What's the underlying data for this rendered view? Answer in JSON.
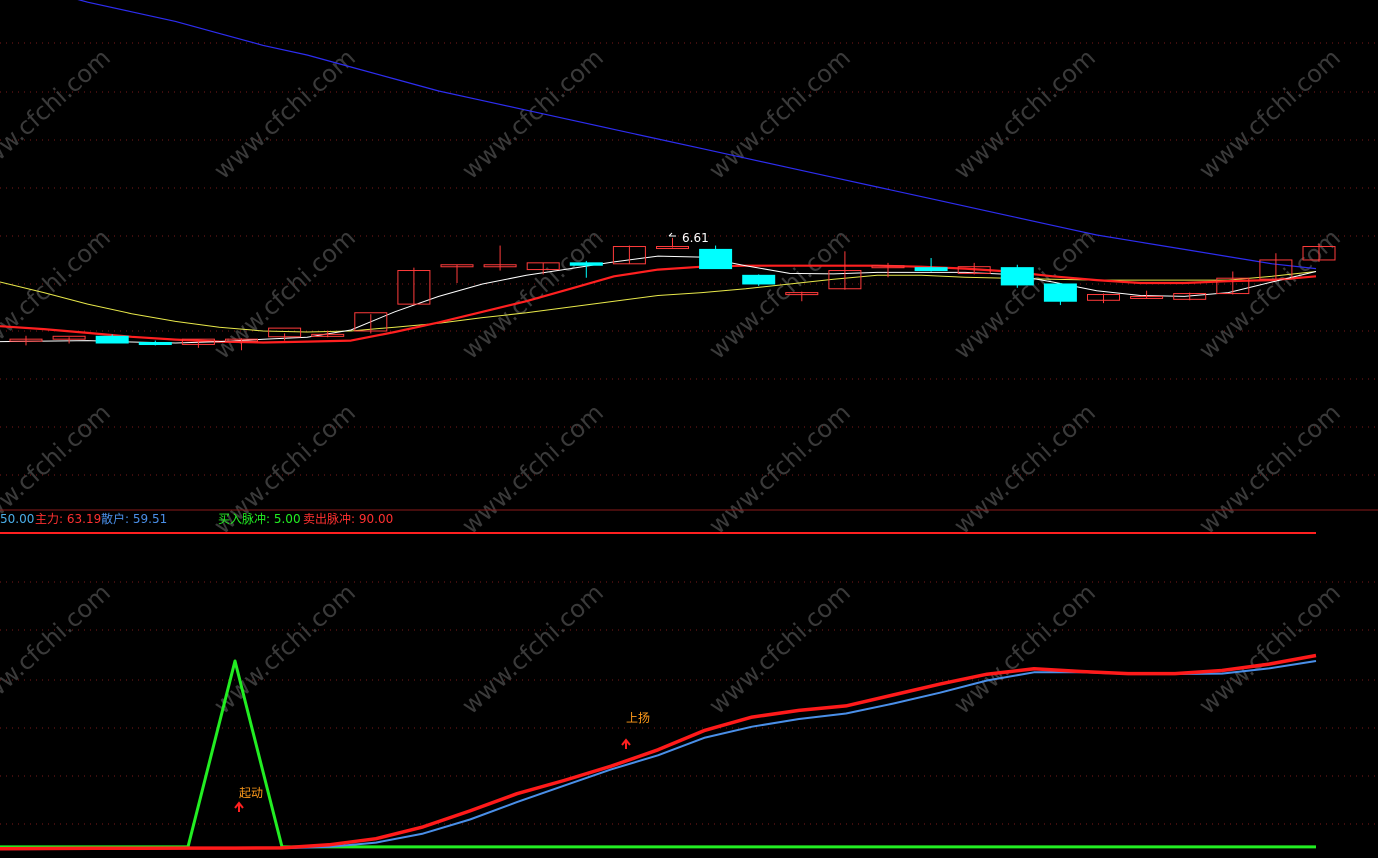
{
  "indicator_bar": {
    "level_label": "50.00",
    "main_label": "主力: 63.19",
    "retail_label": "散户: 59.51",
    "buy_label": "买入脉冲: 5.00",
    "sell_label": "卖出脉冲: 90.00"
  },
  "annotations": {
    "price_high": "6.61",
    "start_label": "起动",
    "rise_label": "上扬"
  },
  "watermark": "www.cfchi.com",
  "colors": {
    "background": "#000000",
    "up_candle": "#ff3b3b",
    "down_candle": "#00ffff",
    "ma_white": "#ffffff",
    "ma_red": "#ff2020",
    "ma_yellow": "#e8e84a",
    "ma_blue": "#2d2df0",
    "main_line": "#ff1a1a",
    "retail_line": "#4a8fe8",
    "pulse_line": "#22ee22",
    "separator": "#ff2020",
    "grid": "#7a1a1a",
    "annotation": "#ff9a1a"
  },
  "chart_data": [
    {
      "type": "candlestick",
      "ylim": [
        0,
        100
      ],
      "candles": [
        {
          "o": 56.0,
          "h": 58.0,
          "l": 54.0,
          "c": 56.6
        },
        {
          "o": 56.6,
          "h": 57.4,
          "l": 54.8,
          "c": 57.8
        },
        {
          "o": 57.8,
          "h": 58.6,
          "l": 55.6,
          "c": 55.0
        },
        {
          "o": 55.2,
          "h": 56.0,
          "l": 54.0,
          "c": 54.4
        },
        {
          "o": 54.4,
          "h": 56.0,
          "l": 53.0,
          "c": 56.6
        },
        {
          "o": 56.0,
          "h": 57.0,
          "l": 52.0,
          "c": 56.6
        },
        {
          "o": 57.6,
          "h": 59.0,
          "l": 56.0,
          "c": 61.2
        },
        {
          "o": 58.6,
          "h": 60.2,
          "l": 57.4,
          "c": 58.6
        },
        {
          "o": 60.0,
          "h": 67.0,
          "l": 59.0,
          "c": 67.6
        },
        {
          "o": 71.2,
          "h": 86.4,
          "l": 70.8,
          "c": 85.2
        },
        {
          "o": 86.8,
          "h": 87.6,
          "l": 80.0,
          "c": 87.6
        },
        {
          "o": 87.6,
          "h": 95.6,
          "l": 85.2,
          "c": 87.6
        },
        {
          "o": 85.6,
          "h": 88.4,
          "l": 83.6,
          "c": 88.4
        },
        {
          "o": 88.4,
          "h": 89.2,
          "l": 82.2,
          "c": 87.4
        },
        {
          "o": 88.0,
          "h": 95.6,
          "l": 88.0,
          "c": 95.2
        },
        {
          "o": 95.2,
          "h": 98.8,
          "l": 94.8,
          "c": 95.2
        },
        {
          "o": 94.0,
          "h": 95.6,
          "l": 87.0,
          "c": 86.0
        },
        {
          "o": 83.2,
          "h": 83.6,
          "l": 78.8,
          "c": 79.6
        },
        {
          "o": 75.2,
          "h": 76.4,
          "l": 72.4,
          "c": 76.0
        },
        {
          "o": 77.6,
          "h": 93.2,
          "l": 77.2,
          "c": 85.2
        },
        {
          "o": 86.8,
          "h": 88.4,
          "l": 82.4,
          "c": 87.2
        },
        {
          "o": 86.4,
          "h": 90.4,
          "l": 84.8,
          "c": 85.2
        },
        {
          "o": 84.0,
          "h": 88.4,
          "l": 83.6,
          "c": 86.8
        },
        {
          "o": 86.4,
          "h": 87.6,
          "l": 78.0,
          "c": 79.2
        },
        {
          "o": 79.6,
          "h": 80.0,
          "l": 70.8,
          "c": 72.4
        },
        {
          "o": 72.8,
          "h": 75.6,
          "l": 71.6,
          "c": 75.2
        },
        {
          "o": 74.4,
          "h": 76.8,
          "l": 73.6,
          "c": 74.4
        },
        {
          "o": 73.2,
          "h": 76.0,
          "l": 72.8,
          "c": 75.6
        },
        {
          "o": 75.6,
          "h": 84.8,
          "l": 75.2,
          "c": 82.0
        },
        {
          "o": 81.6,
          "h": 92.4,
          "l": 80.8,
          "c": 89.6
        },
        {
          "o": 89.6,
          "h": 96.4,
          "l": 88.8,
          "c": 95.2
        }
      ],
      "ma_white": [
        55.6,
        55.8,
        56.0,
        55.4,
        55.0,
        55.6,
        56.6,
        57.4,
        60.4,
        68.0,
        74.4,
        79.6,
        83.2,
        86.0,
        88.8,
        91.2,
        90.8,
        87.2,
        84.0,
        83.8,
        84.4,
        84.4,
        84.4,
        83.6,
        80.4,
        76.8,
        74.8,
        74.4,
        76.0,
        80.4,
        84.8
      ],
      "ma_red": [
        62.0,
        60.8,
        59.2,
        57.6,
        56.4,
        55.6,
        55.2,
        55.6,
        56.0,
        59.6,
        63.6,
        68.0,
        72.4,
        77.6,
        82.8,
        85.6,
        86.8,
        87.2,
        87.2,
        87.2,
        87.2,
        86.8,
        86.0,
        84.8,
        82.8,
        81.2,
        80.0,
        80.0,
        80.8,
        81.2,
        82.8
      ],
      "ma_yellow": [
        80.4,
        76.0,
        71.2,
        67.2,
        64.0,
        61.6,
        60.0,
        59.6,
        60.0,
        61.6,
        63.2,
        65.6,
        67.6,
        70.0,
        72.4,
        74.8,
        76.0,
        77.6,
        79.6,
        81.6,
        83.2,
        83.2,
        82.4,
        82.0,
        81.6,
        81.2,
        81.2,
        81.2,
        81.2,
        82.8,
        84.8
      ],
      "ma_blue": [
        207.0,
        202.0,
        197.0,
        193.0,
        189.0,
        184.0,
        179.0,
        175.0,
        170.0,
        165.0,
        160.0,
        156.0,
        152.0,
        148.0,
        144.0,
        140.0,
        136.0,
        132.0,
        128.0,
        124.0,
        120.0,
        116.0,
        112.0,
        108.0,
        104.0,
        100.0,
        97.0,
        94.0,
        91.0,
        88.0,
        86.0
      ]
    },
    {
      "type": "line",
      "ylim": [
        0,
        100
      ],
      "series": [
        {
          "name": "主力",
          "values": [
            0.6,
            0.7,
            0.8,
            0.8,
            0.9,
            0.9,
            1.0,
            2.5,
            5.4,
            11.0,
            18.6,
            26.8,
            33.1,
            39.9,
            47.7,
            57.0,
            63.3,
            66.5,
            68.6,
            73.8,
            79.0,
            83.7,
            86.3,
            85.0,
            84.0,
            84.0,
            85.5,
            88.5,
            92.6
          ]
        },
        {
          "name": "散户",
          "values": [
            0.4,
            0.5,
            0.6,
            0.6,
            0.7,
            0.7,
            0.8,
            1.5,
            3.5,
            7.8,
            14.5,
            22.8,
            30.6,
            38.4,
            45.1,
            53.5,
            58.7,
            62.4,
            65.0,
            69.7,
            74.9,
            80.7,
            84.6,
            84.6,
            83.8,
            83.8,
            84.0,
            86.5,
            90.0
          ]
        },
        {
          "name": "买入脉冲",
          "values": [
            1.5,
            1.5,
            1.5,
            1.5,
            1.5,
            90.0,
            1.5,
            1.5,
            1.5,
            1.5,
            1.5,
            1.5,
            1.5,
            1.5,
            1.5,
            1.5,
            1.5,
            1.5,
            1.5,
            1.5,
            1.5,
            1.5,
            1.5,
            1.5,
            1.5,
            1.5,
            1.5,
            1.5,
            1.5
          ]
        }
      ]
    }
  ]
}
